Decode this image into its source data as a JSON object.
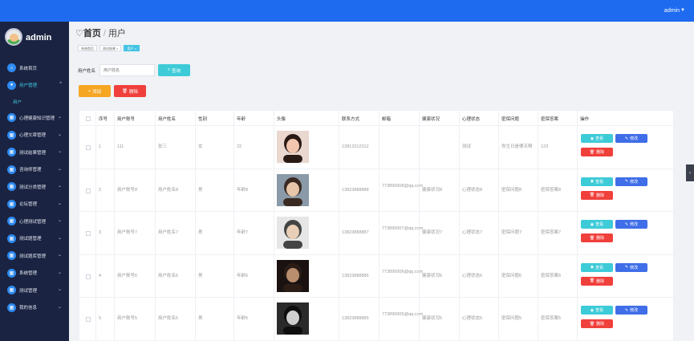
{
  "topbar": {
    "user": "admin",
    "caret": "▼"
  },
  "sidebar": {
    "brand": "admin",
    "items": [
      {
        "label": "系统首页",
        "icon": "home-icon",
        "arrow": ""
      },
      {
        "label": "用户管理",
        "icon": "user-icon",
        "arrow": "^",
        "active": true
      },
      {
        "label": "用户",
        "sub": true
      },
      {
        "label": "心理健康知识管理",
        "icon": "grid-icon",
        "arrow": "⌄"
      },
      {
        "label": "心理文章管理",
        "icon": "grid-icon",
        "arrow": "⌄"
      },
      {
        "label": "测试结果管理",
        "icon": "grid-icon",
        "arrow": "⌄"
      },
      {
        "label": "咨询师管理",
        "icon": "grid-icon",
        "arrow": "⌄"
      },
      {
        "label": "测试分类管理",
        "icon": "grid-icon",
        "arrow": "⌄"
      },
      {
        "label": "论坛管理",
        "icon": "grid-icon",
        "arrow": "⌄"
      },
      {
        "label": "心理测试管理",
        "icon": "grid-icon",
        "arrow": "⌄"
      },
      {
        "label": "测试题管理",
        "icon": "grid-icon",
        "arrow": "⌄"
      },
      {
        "label": "测试题库管理",
        "icon": "grid-icon",
        "arrow": "⌄"
      },
      {
        "label": "系统管理",
        "icon": "grid-icon",
        "arrow": "⌄"
      },
      {
        "label": "测试管理",
        "icon": "grid-icon",
        "arrow": "⌄"
      },
      {
        "label": "我的信息",
        "icon": "grid-icon",
        "arrow": "⌄"
      }
    ]
  },
  "breadcrumb": {
    "home": "首页",
    "sep": "/",
    "current": "用户"
  },
  "tags": [
    "系统首页",
    "测试结果 ×",
    "用户 ×"
  ],
  "search": {
    "label": "用户姓名",
    "placeholder": "用户姓名",
    "button": "查询"
  },
  "actions": {
    "add": "添加",
    "delete": "删除"
  },
  "table": {
    "headers": [
      "序号",
      "用户账号",
      "用户姓名",
      "性别",
      "年龄",
      "头像",
      "联系方式",
      "邮箱",
      "健康状况",
      "心理状态",
      "密保问题",
      "密保答案",
      "操作"
    ],
    "rows": [
      {
        "no": "1",
        "account": "111",
        "name": "张三",
        "gender": "女",
        "age": "22",
        "phone": "13812312312",
        "email": "",
        "health": "",
        "mental": "测试",
        "question": "你生日是哪天啊",
        "answer": "123"
      },
      {
        "no": "2",
        "account": "用户账号8",
        "name": "用户姓名8",
        "gender": "男",
        "age": "年龄8",
        "phone": "13823888888",
        "email": "773890008@qq.com",
        "health": "健康状况8",
        "mental": "心理状态8",
        "question": "密保问题8",
        "answer": "密保答案8"
      },
      {
        "no": "3",
        "account": "用户账号7",
        "name": "用户姓名7",
        "gender": "男",
        "age": "年龄7",
        "phone": "13823888887",
        "email": "773890007@qq.com",
        "health": "健康状况7",
        "mental": "心理状态7",
        "question": "密保问题7",
        "answer": "密保答案7"
      },
      {
        "no": "4",
        "account": "用户账号6",
        "name": "用户姓名6",
        "gender": "男",
        "age": "年龄6",
        "phone": "13823888886",
        "email": "773890006@qq.com",
        "health": "健康状况6",
        "mental": "心理状态6",
        "question": "密保问题6",
        "answer": "密保答案6"
      },
      {
        "no": "5",
        "account": "用户账号5",
        "name": "用户姓名5",
        "gender": "男",
        "age": "年龄5",
        "phone": "13823888885",
        "email": "773890005@qq.com",
        "health": "健康状况5",
        "mental": "心理状态5",
        "question": "密保问题5",
        "answer": "密保答案5"
      }
    ],
    "ops": {
      "view": "查看",
      "edit": "修改",
      "delete": "删除"
    }
  },
  "colors": {
    "topbar": "#1e6bf0",
    "sidebar": "#1a2341",
    "view": "#3ecbd8",
    "edit": "#3f6ee8",
    "delete": "#f0403c",
    "add": "#f5a623"
  }
}
